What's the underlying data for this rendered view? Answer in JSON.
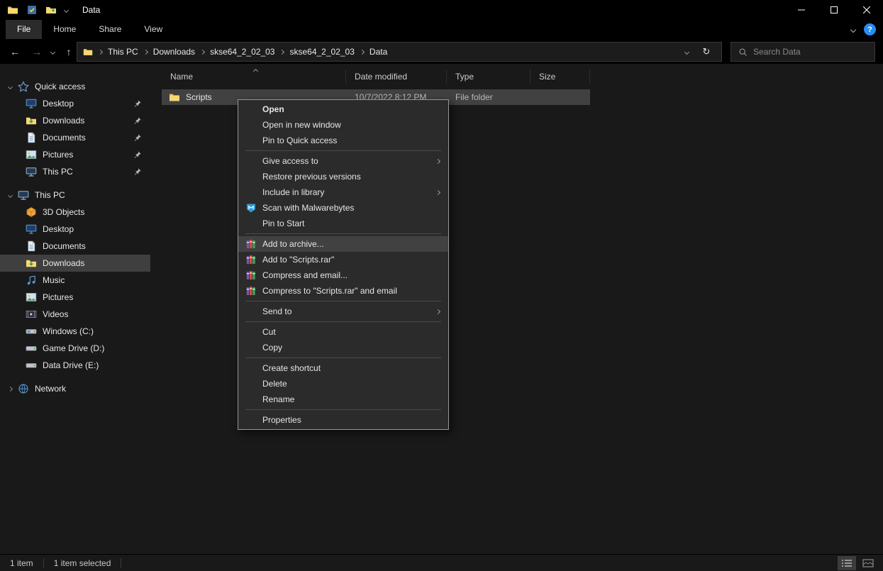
{
  "window": {
    "title": "Data"
  },
  "icons": {
    "back_glyph": "←",
    "forward_glyph": "→",
    "up_glyph": "↑",
    "refresh_glyph": "↻",
    "help_glyph": "?"
  },
  "ribbon": {
    "tabs": [
      {
        "label": "File",
        "active": true
      },
      {
        "label": "Home",
        "active": false
      },
      {
        "label": "Share",
        "active": false
      },
      {
        "label": "View",
        "active": false
      }
    ]
  },
  "address_bar": {
    "breadcrumbs": [
      "This PC",
      "Downloads",
      "skse64_2_02_03",
      "skse64_2_02_03",
      "Data"
    ],
    "search_placeholder": "Search Data"
  },
  "sidebar": {
    "sections": [
      {
        "label": "Quick access",
        "icon": "star",
        "expanded": true,
        "items": [
          {
            "label": "Desktop",
            "icon": "monitor",
            "pinned": true
          },
          {
            "label": "Downloads",
            "icon": "downloads",
            "pinned": true
          },
          {
            "label": "Documents",
            "icon": "document",
            "pinned": true
          },
          {
            "label": "Pictures",
            "icon": "picture",
            "pinned": true
          },
          {
            "label": "This PC",
            "icon": "computer",
            "pinned": true
          }
        ]
      },
      {
        "label": "This PC",
        "icon": "computer",
        "expanded": true,
        "items": [
          {
            "label": "3D Objects",
            "icon": "cube"
          },
          {
            "label": "Desktop",
            "icon": "monitor"
          },
          {
            "label": "Documents",
            "icon": "document"
          },
          {
            "label": "Downloads",
            "icon": "downloads",
            "selected": true
          },
          {
            "label": "Music",
            "icon": "music"
          },
          {
            "label": "Pictures",
            "icon": "picture"
          },
          {
            "label": "Videos",
            "icon": "video"
          },
          {
            "label": "Windows (C:)",
            "icon": "drive-windows"
          },
          {
            "label": "Game Drive (D:)",
            "icon": "drive"
          },
          {
            "label": "Data Drive (E:)",
            "icon": "drive"
          }
        ]
      },
      {
        "label": "Network",
        "icon": "network",
        "expanded": false,
        "items": []
      }
    ]
  },
  "file_list": {
    "columns": [
      "Name",
      "Date modified",
      "Type",
      "Size"
    ],
    "rows": [
      {
        "name": "Scripts",
        "date_modified": "10/7/2022 8:12 PM",
        "type": "File folder",
        "size": "",
        "icon": "folder",
        "selected": true
      }
    ]
  },
  "context_menu": {
    "items": [
      {
        "type": "item",
        "label": "Open",
        "bold": true
      },
      {
        "type": "item",
        "label": "Open in new window"
      },
      {
        "type": "item",
        "label": "Pin to Quick access"
      },
      {
        "type": "separator"
      },
      {
        "type": "item",
        "label": "Give access to",
        "submenu": true
      },
      {
        "type": "item",
        "label": "Restore previous versions"
      },
      {
        "type": "item",
        "label": "Include in library",
        "submenu": true
      },
      {
        "type": "item",
        "label": "Scan with Malwarebytes",
        "icon": "malwarebytes"
      },
      {
        "type": "item",
        "label": "Pin to Start"
      },
      {
        "type": "separator"
      },
      {
        "type": "item",
        "label": "Add to archive...",
        "icon": "winrar",
        "highlighted": true
      },
      {
        "type": "item",
        "label": "Add to \"Scripts.rar\"",
        "icon": "winrar"
      },
      {
        "type": "item",
        "label": "Compress and email...",
        "icon": "winrar"
      },
      {
        "type": "item",
        "label": "Compress to \"Scripts.rar\" and email",
        "icon": "winrar"
      },
      {
        "type": "separator"
      },
      {
        "type": "item",
        "label": "Send to",
        "submenu": true
      },
      {
        "type": "separator"
      },
      {
        "type": "item",
        "label": "Cut"
      },
      {
        "type": "item",
        "label": "Copy"
      },
      {
        "type": "separator"
      },
      {
        "type": "item",
        "label": "Create shortcut"
      },
      {
        "type": "item",
        "label": "Delete"
      },
      {
        "type": "item",
        "label": "Rename"
      },
      {
        "type": "separator"
      },
      {
        "type": "item",
        "label": "Properties"
      }
    ]
  },
  "status_bar": {
    "items_count": "1 item",
    "selected_count": "1 item selected"
  }
}
